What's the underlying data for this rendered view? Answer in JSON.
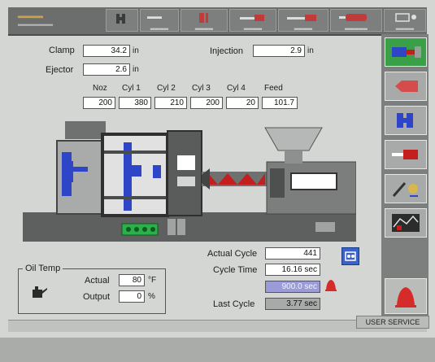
{
  "topbar": {
    "logo_line1": "▂▂▂▂▂",
    "logo_line2": "▂▂▂▂▂▂▂▂",
    "buttons": [
      {
        "caption": ""
      },
      {
        "caption": "▂▂▂▂"
      },
      {
        "caption": "▂▂▂▂"
      },
      {
        "caption": "▂▂▂▂"
      },
      {
        "caption": "▂▂▂▂"
      },
      {
        "caption": "▂▂▂▂▂"
      },
      {
        "caption": "▂▂▂▂"
      }
    ],
    "t2_icon_text": "▬▬"
  },
  "fields": {
    "clamp_label": "Clamp",
    "clamp_value": "34.2",
    "clamp_unit": "in",
    "ejector_label": "Ejector",
    "ejector_value": "2.6",
    "ejector_unit": "in",
    "injection_label": "Injection",
    "injection_value": "2.9",
    "injection_unit": "in"
  },
  "temps": {
    "headers": [
      "Noz",
      "Cyl 1",
      "Cyl 2",
      "Cyl 3",
      "Cyl 4",
      "Feed"
    ],
    "values": [
      "200",
      "380",
      "210",
      "200",
      "20",
      "101.7"
    ]
  },
  "oil_temp": {
    "title": "Oil Temp",
    "actual_label": "Actual",
    "actual_value": "80",
    "actual_unit": "°F",
    "output_label": "Output",
    "output_value": "0",
    "output_unit": "%"
  },
  "cycle": {
    "actual_cycle_label": "Actual Cycle",
    "actual_cycle_value": "441",
    "cycle_time_label": "Cycle Time",
    "cycle_time_value": "16.16 sec",
    "alarm_time_value": "900.0 sec",
    "last_cycle_label": "Last Cycle",
    "last_cycle_value": "3.77 sec"
  },
  "footer": {
    "user_label": "USER SERVICE"
  },
  "colors": {
    "active_green": "#3aa047",
    "alarm_red": "#d62b2b",
    "screw_red": "#c41f1f",
    "platen_blue": "#2f45c8"
  }
}
